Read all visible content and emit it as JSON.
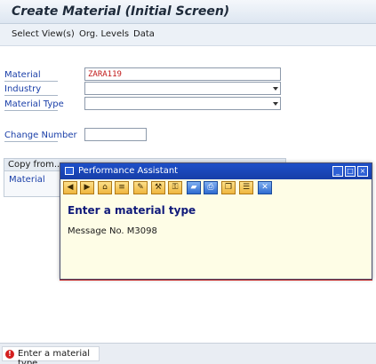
{
  "window": {
    "title": "Create Material (Initial Screen)"
  },
  "menu": {
    "items": [
      "Select View(s)",
      "Org. Levels",
      "Data"
    ]
  },
  "form": {
    "material": {
      "label": "Material",
      "value": "ZARA119"
    },
    "industry": {
      "label": "Industry",
      "value": ""
    },
    "material_type": {
      "label": "Material Type",
      "value": ""
    },
    "change_number": {
      "label": "Change Number",
      "value": ""
    }
  },
  "copy_from": {
    "title": "Copy from...",
    "material_label": "Material"
  },
  "dialog": {
    "title": "Performance Assistant",
    "heading": "Enter a material type",
    "message": "Message No. M3098",
    "tools": [
      "back-icon",
      "forward-icon",
      "home-icon",
      "settings-icon",
      "edit-icon",
      "tools-icon",
      "key-icon",
      "bookmark-icon",
      "print-icon",
      "copy-icon",
      "list-icon",
      "close-icon"
    ]
  },
  "status": {
    "type": "error",
    "text": "Enter a material type",
    "icon_char": "!"
  },
  "colors": {
    "label": "#1a3fa8",
    "input_value": "#c01717",
    "dialog_bg": "#fefde6",
    "dialog_title": "#1d4fc9",
    "error": "#d41f1f"
  }
}
